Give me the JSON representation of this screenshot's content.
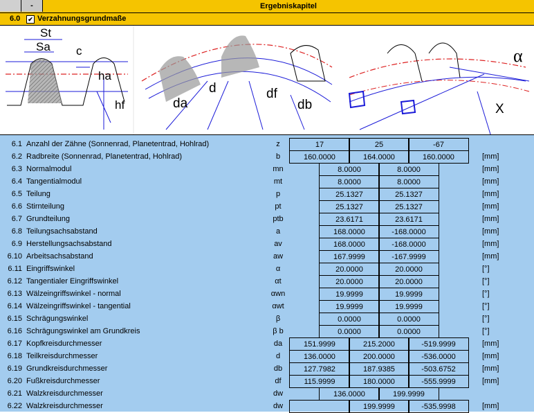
{
  "toolbar": {
    "btn1": "",
    "btn2": "-",
    "title": "Ergebniskapitel"
  },
  "section": {
    "number": "6.0",
    "checked": "✔",
    "title": "Verzahnungsgrundmaße"
  },
  "figure_labels": {
    "st": "St",
    "sa": "Sa",
    "c": "c",
    "ha": "ha",
    "hf": "hf",
    "da": "da",
    "d": "d",
    "df": "df",
    "db": "db",
    "alpha": "α",
    "x": "X"
  },
  "rows": [
    {
      "num": "6.1",
      "label": "Anzahl der Zähne (Sonnenrad, Planetentrad, Hohlrad)",
      "sym": "z",
      "v": [
        "17",
        "25",
        "-67"
      ],
      "unit": ""
    },
    {
      "num": "6.2",
      "label": "Radbreite (Sonnenrad, Planetentrad, Hohlrad)",
      "sym": "b",
      "v": [
        "160.0000",
        "164.0000",
        "160.0000"
      ],
      "unit": "[mm]"
    },
    {
      "num": "6.3",
      "label": "Normalmodul",
      "sym": "mn",
      "v": [
        "8.0000",
        "8.0000"
      ],
      "unit": "[mm]"
    },
    {
      "num": "6.4",
      "label": "Tangentialmodul",
      "sym": "mt",
      "v": [
        "8.0000",
        "8.0000"
      ],
      "unit": "[mm]"
    },
    {
      "num": "6.5",
      "label": "Teilung",
      "sym": "p",
      "v": [
        "25.1327",
        "25.1327"
      ],
      "unit": "[mm]"
    },
    {
      "num": "6.6",
      "label": "Stirnteilung",
      "sym": "pt",
      "v": [
        "25.1327",
        "25.1327"
      ],
      "unit": "[mm]"
    },
    {
      "num": "6.7",
      "label": "Grundteilung",
      "sym": "ptb",
      "v": [
        "23.6171",
        "23.6171"
      ],
      "unit": "[mm]"
    },
    {
      "num": "6.8",
      "label": "Teilungsachsabstand",
      "sym": "a",
      "v": [
        "168.0000",
        "-168.0000"
      ],
      "unit": "[mm]"
    },
    {
      "num": "6.9",
      "label": "Herstellungsachsabstand",
      "sym": "av",
      "v": [
        "168.0000",
        "-168.0000"
      ],
      "unit": "[mm]"
    },
    {
      "num": "6.10",
      "label": "Arbeitsachsabstand",
      "sym": "aw",
      "v": [
        "167.9999",
        "-167.9999"
      ],
      "unit": "[mm]"
    },
    {
      "num": "6.11",
      "label": "Eingriffswinkel",
      "sym": "α",
      "v": [
        "20.0000",
        "20.0000"
      ],
      "unit": "[°]"
    },
    {
      "num": "6.12",
      "label": "Tangentialer Eingriffswinkel",
      "sym": "αt",
      "v": [
        "20.0000",
        "20.0000"
      ],
      "unit": "[°]"
    },
    {
      "num": "6.13",
      "label": "Wälzeingriffswinkel - normal",
      "sym": "αwn",
      "v": [
        "19.9999",
        "19.9999"
      ],
      "unit": "[°]"
    },
    {
      "num": "6.14",
      "label": "Wälzeingriffswinkel - tangential",
      "sym": "αwt",
      "v": [
        "19.9999",
        "19.9999"
      ],
      "unit": "[°]"
    },
    {
      "num": "6.15",
      "label": "Schrägungswinkel",
      "sym": "β",
      "v": [
        "0.0000",
        "0.0000"
      ],
      "unit": "[°]"
    },
    {
      "num": "6.16",
      "label": "Schrägungswinkel am Grundkreis",
      "sym": "β b",
      "v": [
        "0.0000",
        "0.0000"
      ],
      "unit": "[°]"
    },
    {
      "num": "6.17",
      "label": "Kopfkreisdurchmesser",
      "sym": "da",
      "v": [
        "151.9999",
        "215.2000",
        "-519.9999"
      ],
      "unit": "[mm]"
    },
    {
      "num": "6.18",
      "label": "Teilkreisdurchmesser",
      "sym": "d",
      "v": [
        "136.0000",
        "200.0000",
        "-536.0000"
      ],
      "unit": "[mm]"
    },
    {
      "num": "6.19",
      "label": "Grundkreisdurchmesser",
      "sym": "db",
      "v": [
        "127.7982",
        "187.9385",
        "-503.6752"
      ],
      "unit": "[mm]"
    },
    {
      "num": "6.20",
      "label": "Fußkreisdurchmesser",
      "sym": "df",
      "v": [
        "115.9999",
        "180.0000",
        "-555.9999"
      ],
      "unit": "[mm]"
    },
    {
      "num": "6.21",
      "label": "Walzkreisdurchmesser",
      "sym": "dw",
      "v": [
        "136.0000",
        "199.9999"
      ],
      "unit": ""
    },
    {
      "num": "6.22",
      "label": "Walzkreisdurchmesser",
      "sym": "dw",
      "v": [
        "",
        "199.9999",
        "-535.9998"
      ],
      "unit": "[mm]"
    }
  ]
}
